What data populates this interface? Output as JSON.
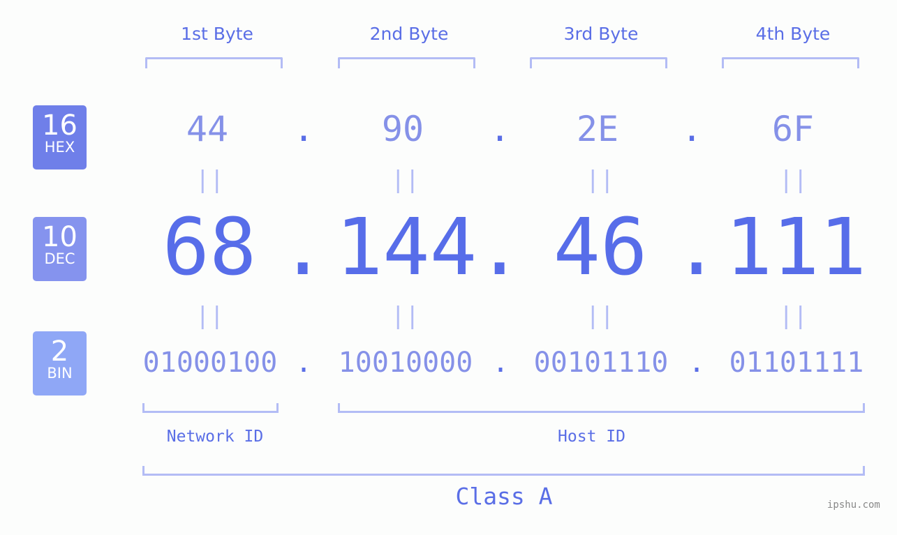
{
  "badges": [
    {
      "number": "16",
      "label": "HEX",
      "color": "#6f7fe9"
    },
    {
      "number": "10",
      "label": "DEC",
      "color": "#8593ee"
    },
    {
      "number": "2",
      "label": "BIN",
      "color": "#8fa7f6"
    }
  ],
  "byte_headers": [
    "1st Byte",
    "2nd Byte",
    "3rd Byte",
    "4th Byte"
  ],
  "hex": [
    "44",
    "90",
    "2E",
    "6F"
  ],
  "dec": [
    "68",
    "144",
    "46",
    "111"
  ],
  "bin": [
    "01000100",
    "10010000",
    "00101110",
    "01101111"
  ],
  "separator": ".",
  "equals": "||",
  "network_id_label": "Network ID",
  "host_id_label": "Host ID",
  "class_label": "Class A",
  "watermark": "ipshu.com"
}
